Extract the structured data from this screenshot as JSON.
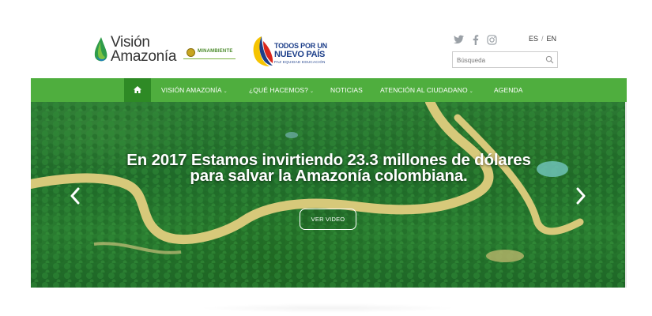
{
  "brand": {
    "vision_line1": "Visión",
    "vision_line2": "Amazonía",
    "minambiente": "MINAMBIENTE",
    "todos_line1": "TODOS POR UN",
    "todos_line2": "NUEVO PAÍS",
    "todos_line3": "PAZ  EQUIDAD  EDUCACIÓN"
  },
  "social": [
    "twitter-icon",
    "facebook-icon",
    "instagram-icon"
  ],
  "language": {
    "es": "ES",
    "separator": "/",
    "en": "EN"
  },
  "search": {
    "placeholder": "Búsqueda",
    "value": ""
  },
  "nav": {
    "items": [
      {
        "label": "VISIÓN AMAZONÍA",
        "has_dropdown": true
      },
      {
        "label": "¿QUÉ HACEMOS?",
        "has_dropdown": true
      },
      {
        "label": "NOTICIAS",
        "has_dropdown": false
      },
      {
        "label": "ATENCIÓN AL CIUDADANO",
        "has_dropdown": true
      },
      {
        "label": "AGENDA",
        "has_dropdown": false
      }
    ],
    "chevron": "⌄"
  },
  "hero": {
    "headline_line1": "En 2017 Estamos invirtiendo 23.3 millones de dólares",
    "headline_line2": "para salvar la Amazonía colombiana.",
    "button_label": "VER VIDEO"
  },
  "colors": {
    "nav_green": "#4fae3e",
    "nav_home": "#2e8a25",
    "river": "#d7c97a"
  }
}
